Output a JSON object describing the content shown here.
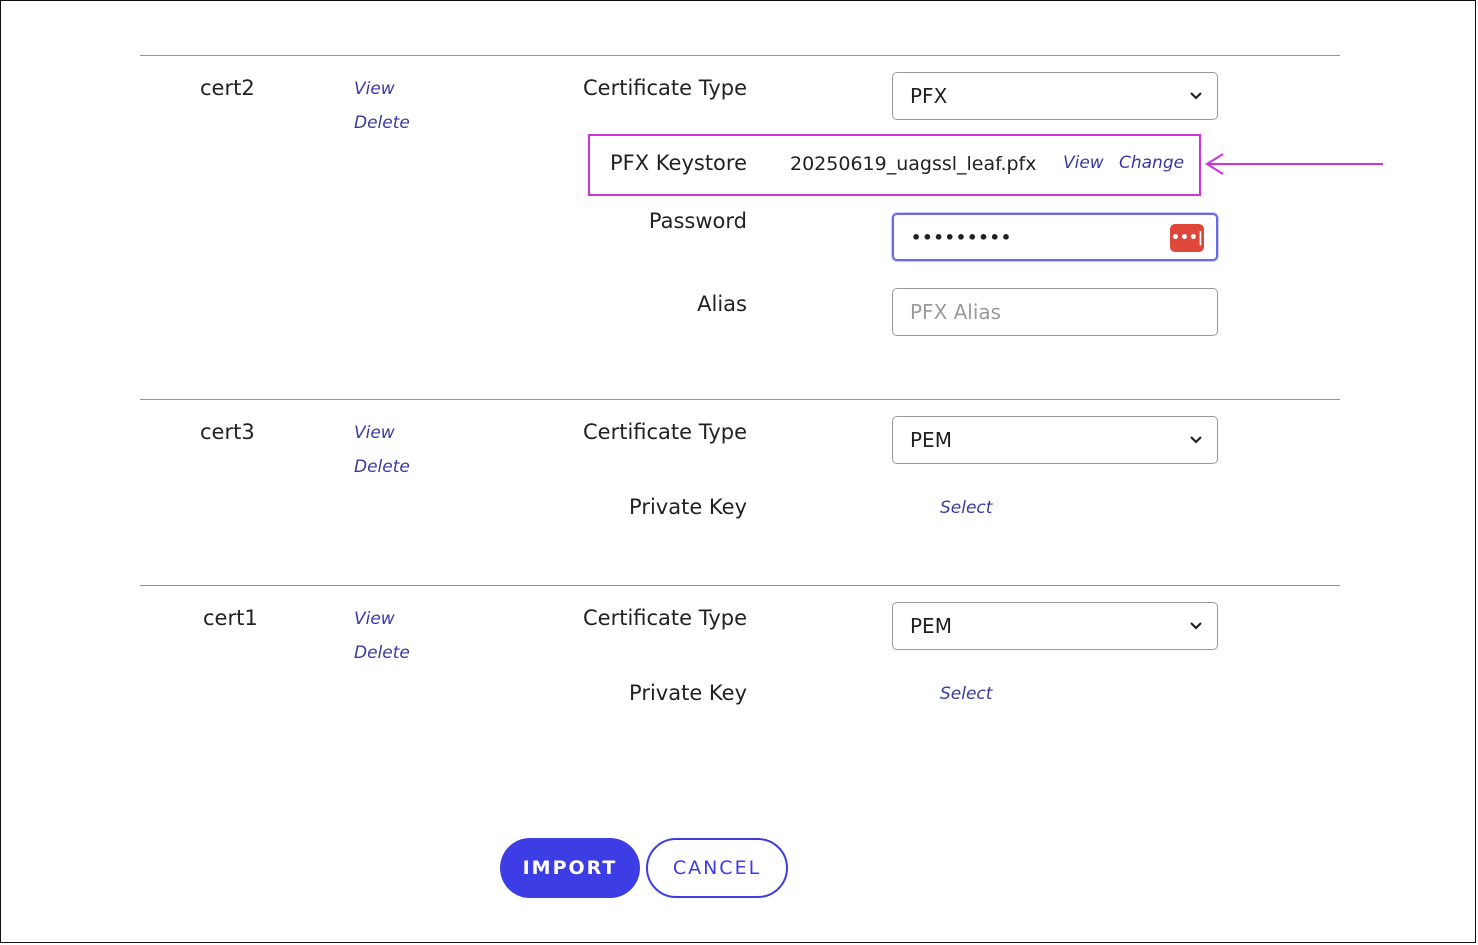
{
  "certs": [
    {
      "name": "cert2",
      "view_label": "View",
      "delete_label": "Delete",
      "cert_type_label": "Certificate Type",
      "cert_type_value": "PFX",
      "keystore_label": "PFX Keystore",
      "keystore_file": "20250619_uagssl_leaf.pfx",
      "keystore_view_label": "View",
      "keystore_change_label": "Change",
      "password_label": "Password",
      "password_value": "•••••••••",
      "alias_label": "Alias",
      "alias_placeholder": "PFX Alias"
    },
    {
      "name": "cert3",
      "view_label": "View",
      "delete_label": "Delete",
      "cert_type_label": "Certificate Type",
      "cert_type_value": "PEM",
      "private_key_label": "Private Key",
      "select_label": "Select"
    },
    {
      "name": "cert1",
      "view_label": "View",
      "delete_label": "Delete",
      "cert_type_label": "Certificate Type",
      "cert_type_value": "PEM",
      "private_key_label": "Private Key",
      "select_label": "Select"
    }
  ],
  "buttons": {
    "import_label": "IMPORT",
    "cancel_label": "CANCEL"
  },
  "colors": {
    "accent": "#3d3de6",
    "highlight": "#cc33dd",
    "password_icon": "#e0473b"
  },
  "icons": {
    "dropdown": "chevron-down-icon",
    "password_manager": "password-manager-icon",
    "annotation_arrow": "left-arrow-icon"
  }
}
